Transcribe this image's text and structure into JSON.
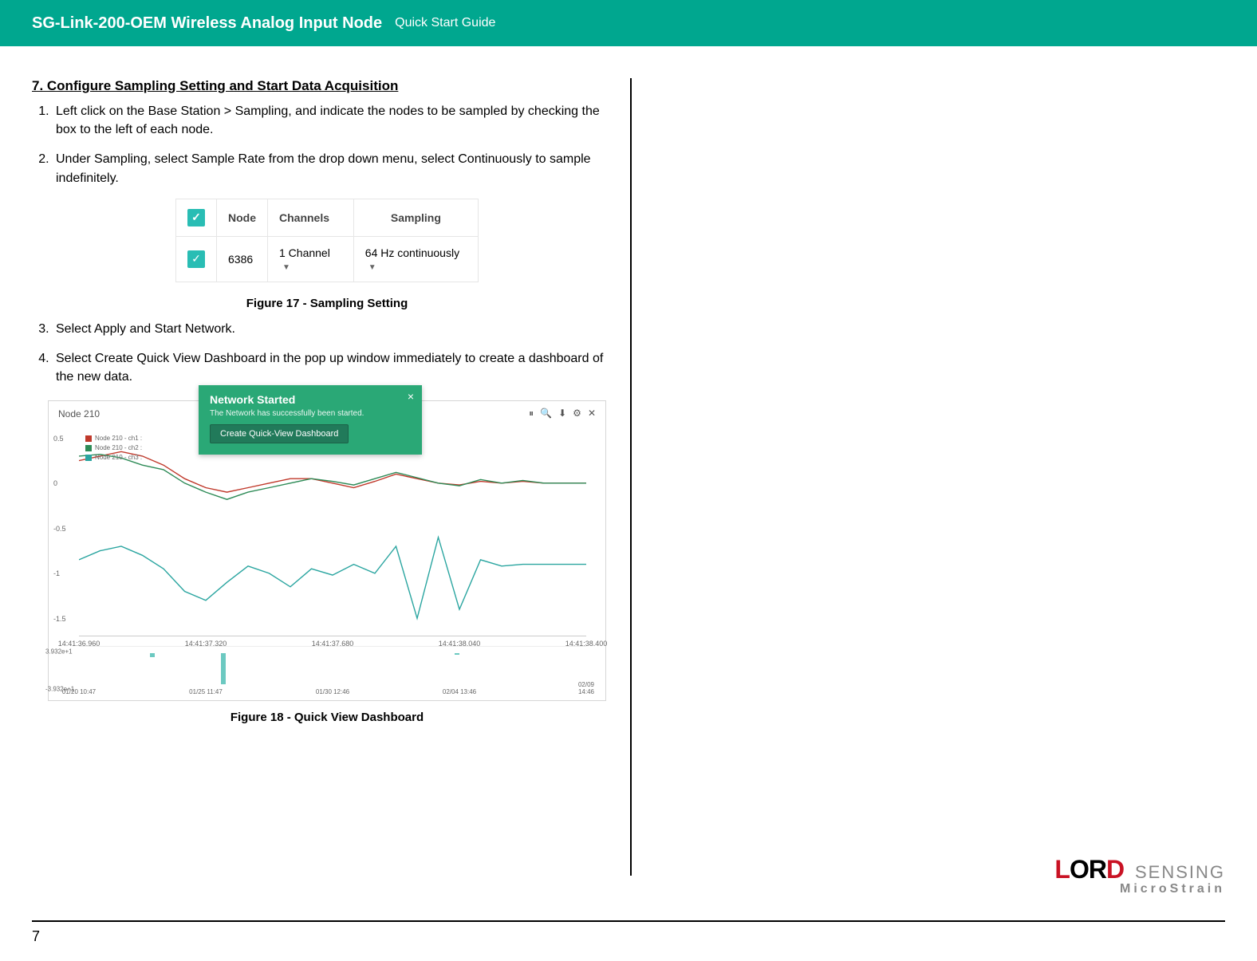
{
  "header": {
    "title": "SG-Link-200-OEM Wireless Analog Input Node",
    "subtitle": "Quick Start Guide"
  },
  "section_title": "7.  Configure Sampling Setting and Start Data Acquisition",
  "steps": [
    "Left click on the Base Station > Sampling, and indicate the nodes to be sampled by checking the box to the left of each node.",
    "Under Sampling, select Sample Rate from the drop down menu, select Continuously to sample indefinitely.",
    "Select Apply and Start Network.",
    "Select Create Quick View Dashboard in the pop up window immediately to create a dashboard of the new data."
  ],
  "figure17": {
    "caption": "Figure 17 - Sampling Setting",
    "headers": {
      "node": "Node",
      "channels": "Channels",
      "sampling": "Sampling"
    },
    "row": {
      "node": "6386",
      "channels": "1 Channel",
      "sampling": "64 Hz continuously"
    }
  },
  "figure18": {
    "caption": "Figure 18 - Quick View Dashboard",
    "notification": {
      "title": "Network Started",
      "message": "The Network has successfully been started.",
      "button": "Create Quick-View Dashboard",
      "close": "×"
    },
    "dash_title": "Node 210",
    "icons": {
      "pause": "⏸",
      "search": "🔍",
      "download": "⬇",
      "gear": "⚙",
      "close": "✕"
    },
    "legend": [
      {
        "label": "Node 210 - ch1 :",
        "color": "#c0392b"
      },
      {
        "label": "Node 210 - ch2 :",
        "color": "#2e8b57"
      },
      {
        "label": "Node 210 - ch3 :",
        "color": "#2aa5a0"
      }
    ],
    "y_ticks": [
      "0.5",
      "0",
      "-0.5",
      "-1",
      "-1.5"
    ],
    "x_ticks": [
      "14:41:36.960",
      "14:41:37.320",
      "14:41:37.680",
      "14:41:38.040",
      "14:41:38.400"
    ],
    "range_y": [
      "3.932e+1",
      "-3.932e+1"
    ],
    "range_x": [
      "01/20 10:47",
      "01/25 11:47",
      "01/30 12:46",
      "02/04 13:46",
      "02/09 14:46"
    ]
  },
  "chart_data": {
    "type": "line",
    "title": "Node 210",
    "ylim": [
      -1.7,
      0.6
    ],
    "y_ticks": [
      0.5,
      0,
      -0.5,
      -1,
      -1.5
    ],
    "x_ticks": [
      "14:41:36.960",
      "14:41:37.320",
      "14:41:37.680",
      "14:41:38.040",
      "14:41:38.400"
    ],
    "legend": [
      "Node 210 - ch1",
      "Node 210 - ch2",
      "Node 210 - ch3"
    ],
    "series": [
      {
        "name": "ch1",
        "color": "#c0392b",
        "values": [
          0.25,
          0.3,
          0.35,
          0.3,
          0.2,
          0.05,
          -0.05,
          -0.1,
          -0.05,
          0.0,
          0.05,
          0.05,
          0.0,
          -0.05,
          0.02,
          0.1,
          0.05,
          0.0,
          -0.02,
          0.02,
          0.0,
          0.02,
          0.0,
          0.0,
          0.0
        ]
      },
      {
        "name": "ch2",
        "color": "#2e8b57",
        "values": [
          0.3,
          0.32,
          0.28,
          0.2,
          0.15,
          0.0,
          -0.1,
          -0.18,
          -0.1,
          -0.05,
          0.0,
          0.05,
          0.02,
          -0.02,
          0.05,
          0.12,
          0.06,
          0.0,
          -0.03,
          0.04,
          0.0,
          0.03,
          0.0,
          0.0,
          0.0
        ]
      },
      {
        "name": "ch3",
        "color": "#2aa5a0",
        "values": [
          -0.85,
          -0.75,
          -0.7,
          -0.8,
          -0.95,
          -1.2,
          -1.3,
          -1.1,
          -0.92,
          -1.0,
          -1.15,
          -0.95,
          -1.02,
          -0.9,
          -1.0,
          -0.7,
          -1.5,
          -0.6,
          -1.4,
          -0.85,
          -0.92,
          -0.9,
          -0.9,
          -0.9,
          -0.9
        ]
      }
    ],
    "overview": {
      "ylim": [
        -39.32,
        39.32
      ],
      "x_ticks": [
        "01/20 10:47",
        "01/25 11:47",
        "01/30 12:46",
        "02/04 13:46",
        "02/09 14:46"
      ],
      "bars": [
        {
          "pos": 0.14,
          "height": 5
        },
        {
          "pos": 0.28,
          "height": 38
        },
        {
          "pos": 0.74,
          "height": 2
        }
      ]
    }
  },
  "page_number": "7",
  "logo": {
    "main1": "L",
    "main2": "OR",
    "main3": "D",
    "sensing": "SENSING",
    "sub": "MicroStrain"
  }
}
